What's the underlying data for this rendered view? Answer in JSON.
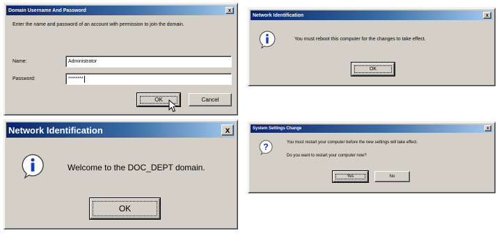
{
  "colors": {
    "dialog_face": "#d4d0c8",
    "title_gradient_start": "#0a246a",
    "title_gradient_end": "#a6caf0",
    "title_text": "#ffffff"
  },
  "dialog1": {
    "title": "Domain Username And Password",
    "close_label": "x",
    "instructions": "Enter the name and password of an account with permission to join the domain.",
    "name_label": "Name:",
    "name_value": "Administrator",
    "password_label": "Password:",
    "password_value": "********",
    "ok_label": "OK",
    "cancel_label": "Cancel"
  },
  "dialog2": {
    "title": "Network Identification",
    "close_label": "x",
    "icon": "info-icon",
    "message": "You must reboot this computer for the changes to take effect.",
    "ok_label": "OK"
  },
  "dialog3": {
    "title": "Network Identification",
    "close_label": "x",
    "icon": "info-icon",
    "message": "Welcome to the DOC_DEPT domain.",
    "ok_label": "OK"
  },
  "dialog4": {
    "title": "System Settings Change",
    "close_label": "x",
    "icon": "question-icon",
    "message_line1": "You must restart your computer before the new settings will take effect.",
    "message_line2": "Do you want to restart your computer now?",
    "yes_label": "Yes",
    "no_label": "No"
  }
}
